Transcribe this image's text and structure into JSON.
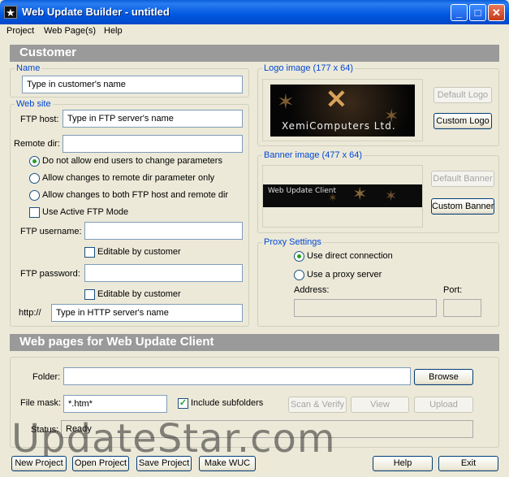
{
  "window": {
    "title": "Web Update Builder - untitled",
    "app_icon": "star-icon"
  },
  "menu": [
    "Project",
    "Web Page(s)",
    "Help"
  ],
  "customer": {
    "header": "Customer",
    "name_group": "Name",
    "name_placeholder": "Type in customer's name",
    "website_group": "Web site",
    "ftp_host_label": "FTP host:",
    "ftp_host_placeholder": "Type in FTP server's name",
    "remote_dir_label": "Remote dir:",
    "remote_dir_value": "",
    "radio_options": [
      {
        "label": "Do not allow end users to change parameters",
        "selected": true
      },
      {
        "label": "Allow changes to remote dir parameter only",
        "selected": false
      },
      {
        "label": "Allow changes to both FTP host and remote dir",
        "selected": false
      }
    ],
    "active_ftp_label": "Use Active FTP Mode",
    "active_ftp_checked": false,
    "ftp_username_label": "FTP username:",
    "ftp_username_value": "",
    "editable_username_label": "Editable by customer",
    "ftp_password_label": "FTP password:",
    "ftp_password_value": "",
    "editable_password_label": "Editable by customer",
    "http_label": "http://",
    "http_placeholder": "Type in HTTP server's name"
  },
  "logo": {
    "group": "Logo image (177 x 64)",
    "image_text": "XemiComputers Ltd.",
    "default_button": "Default Logo",
    "custom_button": "Custom Logo"
  },
  "banner": {
    "group": "Banner image (477 x 64)",
    "image_text": "Web Update Client",
    "default_button": "Default Banner",
    "custom_button": "Custom Banner"
  },
  "proxy": {
    "group": "Proxy Settings",
    "direct_label": "Use direct connection",
    "proxy_label": "Use a proxy server",
    "direct_selected": true,
    "address_label": "Address:",
    "port_label": "Port:",
    "address_value": "",
    "port_value": ""
  },
  "webpages": {
    "header": "Web pages for Web Update Client",
    "folder_label": "Folder:",
    "folder_value": "",
    "browse_button": "Browse",
    "file_mask_label": "File mask:",
    "file_mask_value": "*.htm*",
    "include_subfolders_label": "Include subfolders",
    "include_subfolders_checked": true,
    "scan_button": "Scan & Verify",
    "view_button": "View",
    "upload_button": "Upload",
    "status_label": "Status:",
    "status_value": "Ready"
  },
  "bottom_buttons": {
    "new_project": "New Project",
    "open_project": "Open Project",
    "save_project": "Save Project",
    "make_wuc": "Make WUC",
    "help": "Help",
    "exit": "Exit"
  },
  "watermark": "UpdateStar.com",
  "colors": {
    "title_bar": "#0058e0",
    "section_header": "#9a9a9a",
    "group_label": "#0046d5",
    "window_bg": "#ece9d8"
  }
}
